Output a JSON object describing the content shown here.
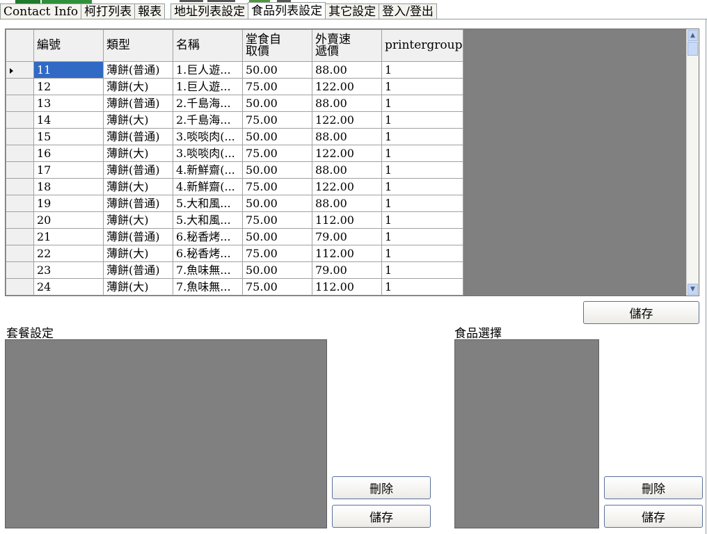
{
  "tabs": [
    {
      "label": "Contact Info",
      "active": false
    },
    {
      "label": "柯打列表",
      "active": false
    },
    {
      "label": "報表",
      "active": false
    },
    {
      "label": "地址列表設定",
      "active": false
    },
    {
      "label": "食品列表設定",
      "active": true
    },
    {
      "label": "其它設定",
      "active": false
    },
    {
      "label": "登入/登出",
      "active": false
    }
  ],
  "grid": {
    "columns": [
      "編號",
      "類型",
      "名稱",
      "堂食自取價",
      "外賣速遞價",
      "printergroup"
    ],
    "column_header_lines": [
      [
        "編號"
      ],
      [
        "類型"
      ],
      [
        "名稱"
      ],
      [
        "堂食自",
        "取價"
      ],
      [
        "外賣速",
        "遞價"
      ],
      [
        "printergroup"
      ]
    ],
    "rows": [
      {
        "id": "11",
        "type": "薄餅(普通)",
        "name": "1.巨人遊...",
        "dine_in": "50.00",
        "delivery": "88.00",
        "printergroup": "1"
      },
      {
        "id": "12",
        "type": "薄餅(大)",
        "name": "1.巨人遊...",
        "dine_in": "75.00",
        "delivery": "122.00",
        "printergroup": "1"
      },
      {
        "id": "13",
        "type": "薄餅(普通)",
        "name": "2.千島海...",
        "dine_in": "50.00",
        "delivery": "88.00",
        "printergroup": "1"
      },
      {
        "id": "14",
        "type": "薄餅(大)",
        "name": "2.千島海...",
        "dine_in": "75.00",
        "delivery": "122.00",
        "printergroup": "1"
      },
      {
        "id": "15",
        "type": "薄餅(普通)",
        "name": "3.啖啖肉(...",
        "dine_in": "50.00",
        "delivery": "88.00",
        "printergroup": "1"
      },
      {
        "id": "16",
        "type": "薄餅(大)",
        "name": "3.啖啖肉(...",
        "dine_in": "75.00",
        "delivery": "122.00",
        "printergroup": "1"
      },
      {
        "id": "17",
        "type": "薄餅(普通)",
        "name": "4.新鮮齋(...",
        "dine_in": "50.00",
        "delivery": "88.00",
        "printergroup": "1"
      },
      {
        "id": "18",
        "type": "薄餅(大)",
        "name": "4.新鮮齋(...",
        "dine_in": "75.00",
        "delivery": "122.00",
        "printergroup": "1"
      },
      {
        "id": "19",
        "type": "薄餅(普通)",
        "name": "5.大和風...",
        "dine_in": "50.00",
        "delivery": "88.00",
        "printergroup": "1"
      },
      {
        "id": "20",
        "type": "薄餅(大)",
        "name": "5.大和風...",
        "dine_in": "75.00",
        "delivery": "112.00",
        "printergroup": "1"
      },
      {
        "id": "21",
        "type": "薄餅(普通)",
        "name": "6.秘香烤...",
        "dine_in": "50.00",
        "delivery": "79.00",
        "printergroup": "1"
      },
      {
        "id": "22",
        "type": "薄餅(大)",
        "name": "6.秘香烤...",
        "dine_in": "75.00",
        "delivery": "112.00",
        "printergroup": "1"
      },
      {
        "id": "23",
        "type": "薄餅(普通)",
        "name": "7.魚味無...",
        "dine_in": "50.00",
        "delivery": "79.00",
        "printergroup": "1"
      },
      {
        "id": "24",
        "type": "薄餅(大)",
        "name": "7.魚味無...",
        "dine_in": "75.00",
        "delivery": "112.00",
        "printergroup": "1"
      }
    ],
    "selected_row": 0,
    "current_row_indicator": "row-pointer-icon"
  },
  "grid_save_label": "儲存",
  "set_meal": {
    "title": "套餐設定",
    "delete_label": "刪除",
    "save_label": "儲存"
  },
  "food_selection": {
    "title": "食品選擇",
    "delete_label": "刪除",
    "save_label": "儲存"
  },
  "colors": {
    "selection": "#316ac5",
    "empty_area": "#808080",
    "header_bg": "#f0f0f0"
  }
}
